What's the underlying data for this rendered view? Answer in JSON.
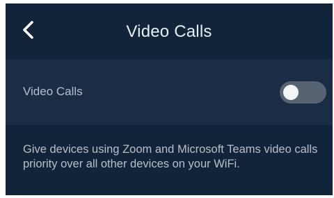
{
  "header": {
    "title": "Video Calls",
    "back_icon": "chevron-left-icon"
  },
  "setting": {
    "label": "Video Calls",
    "toggle_state": "off"
  },
  "description": "Give devices using Zoom and Microsoft Teams video calls priority over all other devices on your WiFi.",
  "colors": {
    "background": "#112439",
    "row_background": "#1a2d44",
    "toggle_off_track": "#576373",
    "toggle_knob": "#f2f4f6",
    "title_text": "#e9edf2",
    "body_text": "#b7c0cb"
  }
}
